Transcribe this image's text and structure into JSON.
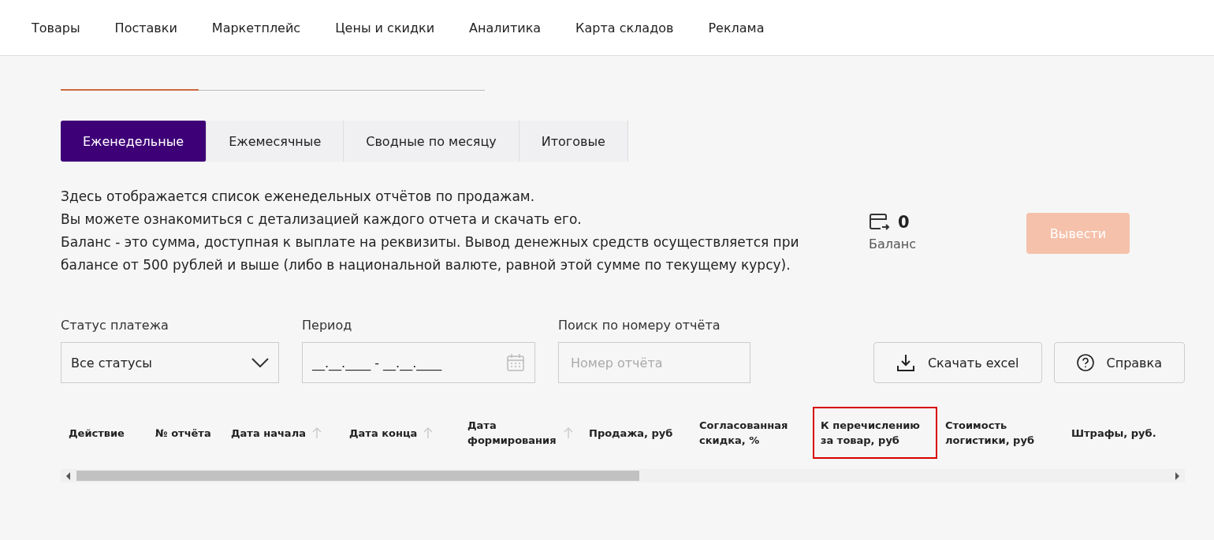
{
  "nav": [
    {
      "label": "Товары"
    },
    {
      "label": "Поставки"
    },
    {
      "label": "Маркетплейс"
    },
    {
      "label": "Цены и скидки"
    },
    {
      "label": "Аналитика"
    },
    {
      "label": "Карта складов"
    },
    {
      "label": "Реклама"
    }
  ],
  "tabs": [
    {
      "label": "Еженедельные",
      "selected": true
    },
    {
      "label": "Ежемесячные",
      "selected": false
    },
    {
      "label": "Сводные по месяцу",
      "selected": false
    },
    {
      "label": "Итоговые",
      "selected": false
    }
  ],
  "description": [
    "Здесь отображается список еженедельных отчётов по продажам.",
    "Вы можете ознакомиться с детализацией каждого отчета и скачать его.",
    "Баланс - это сумма, доступная к выплате на реквизиты. Вывод денежных средств осуществляется при балансе от 500 рублей и выше (либо в национальной валюте, равной этой сумме по текущему курсу)."
  ],
  "balance": {
    "value": "0",
    "label": "Баланс",
    "button": "Вывести",
    "button_disabled": true
  },
  "filters": {
    "status": {
      "label": "Статус платежа",
      "value": "Все статусы"
    },
    "period": {
      "label": "Период",
      "value": "__.__.____ - __.__.____"
    },
    "search": {
      "label": "Поиск по номеру отчёта",
      "placeholder": "Номер отчёта"
    }
  },
  "actions": [
    {
      "kind": "download",
      "label": "Скачать excel"
    },
    {
      "kind": "help",
      "label": "Справка"
    }
  ],
  "table": {
    "columns": [
      {
        "label": "Действие",
        "sortable": false,
        "highlighted": false
      },
      {
        "label": "№ отчёта",
        "sortable": false,
        "highlighted": false
      },
      {
        "label": "Дата начала",
        "sortable": true,
        "highlighted": false
      },
      {
        "label": "Дата конца",
        "sortable": true,
        "highlighted": false
      },
      {
        "label": "Дата формирования",
        "sortable": true,
        "highlighted": false
      },
      {
        "label": "Продажа, руб",
        "sortable": false,
        "highlighted": false
      },
      {
        "label": "Согласованная скидка, %",
        "sortable": false,
        "highlighted": false
      },
      {
        "label": "К перечислению за товар, руб",
        "sortable": false,
        "highlighted": true
      },
      {
        "label": "Стоимость логистики, руб",
        "sortable": false,
        "highlighted": false
      },
      {
        "label": "Штрафы, руб.",
        "sortable": false,
        "highlighted": false
      }
    ]
  }
}
